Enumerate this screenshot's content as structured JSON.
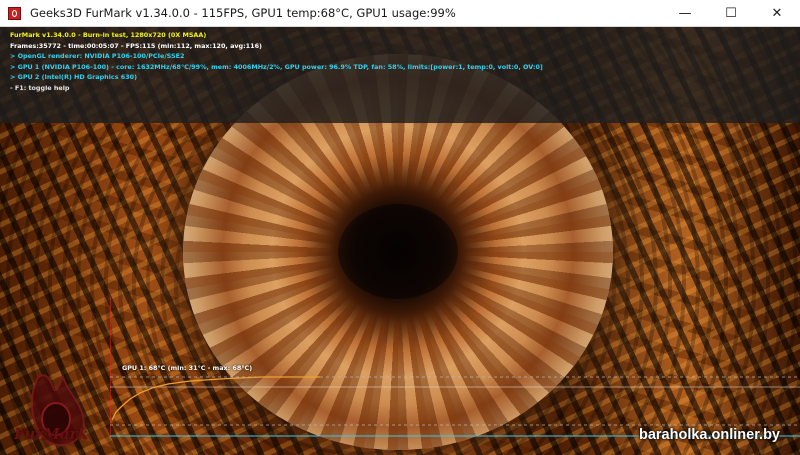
{
  "window": {
    "title": "Geeks3D FurMark v1.34.0.0 - 115FPS, GPU1 temp:68°C, GPU1 usage:99%",
    "icon": "furmark-app-icon",
    "controls": {
      "minimize": "—",
      "maximize": "☐",
      "close": "✕"
    }
  },
  "info": {
    "line1": "FurMark v1.34.0.0 - Burn-in test, 1280x720 (0X MSAA)",
    "line2": "Frames:35772 - time:00:05:07 - FPS:115 (min:112, max:120, avg:116)",
    "line3": "> OpenGL renderer: NVIDIA P106-100/PCIe/SSE2",
    "line4": "> GPU 1 (NVIDIA P106-100) - core: 1632MHz/68°C/99%, mem: 4006MHz/2%, GPU power: 96.9% TDP, fan: 58%, limits:[power:1, temp:0, volt:0, OV:0]",
    "line5": "> GPU 2 (Intel(R) HD Graphics 630)",
    "line6": "- F1: toggle help"
  },
  "graph": {
    "label": "GPU 1: 68°C (min: 31°C - max: 68°C)",
    "current_temp_c": 68,
    "min_temp_c": 31,
    "max_temp_c": 68
  },
  "logo": {
    "text": "FurMark"
  },
  "watermark": "baraholka.onliner.by",
  "colors": {
    "info_yellow": "#f3f31a",
    "info_cyan": "#30d2f0",
    "graph_line": "#f0a030",
    "graph_axis": "#3cc8e6",
    "graph_marker": "#e8221c"
  }
}
